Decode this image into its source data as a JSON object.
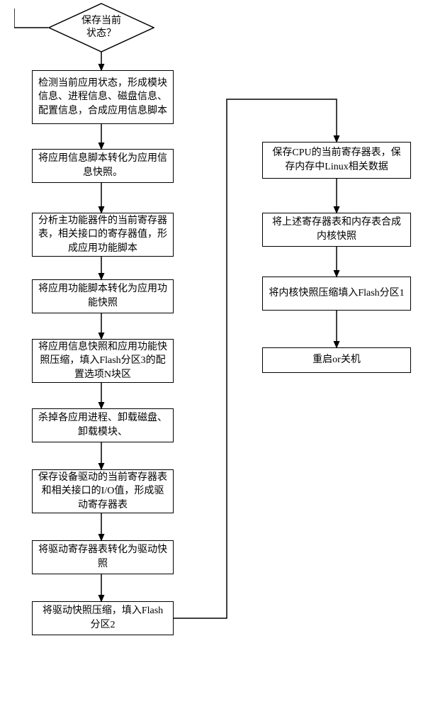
{
  "chart_data": {
    "type": "flowchart",
    "direction": "top-to-bottom",
    "nodes": [
      {
        "id": "d1",
        "type": "decision",
        "text": "保存当前\n状态？"
      },
      {
        "id": "p1",
        "type": "process",
        "text": "检测当前应用状态，形成模块信息、进程信息、磁盘信息、配置信息，合成应用信息脚本"
      },
      {
        "id": "p2",
        "type": "process",
        "text": "将应用信息脚本转化为应用信息快照。"
      },
      {
        "id": "p3",
        "type": "process",
        "text": "分析主功能器件的当前寄存器表，相关接口的寄存器值，形成应用功能脚本"
      },
      {
        "id": "p4",
        "type": "process",
        "text": "将应用功能脚本转化为应用功能快照"
      },
      {
        "id": "p5",
        "type": "process",
        "text": "将应用信息快照和应用功能快照压缩，填入Flash分区3的配置选项N块区"
      },
      {
        "id": "p6",
        "type": "process",
        "text": "杀掉各应用进程、卸载磁盘、卸载模块、"
      },
      {
        "id": "p7",
        "type": "process",
        "text": "保存设备驱动的当前寄存器表和相关接口的I/O值，形成驱动寄存器表"
      },
      {
        "id": "p8",
        "type": "process",
        "text": "将驱动寄存器表转化为驱动快照"
      },
      {
        "id": "p9",
        "type": "process",
        "text": "将驱动快照压缩，填入Flash分区2"
      },
      {
        "id": "p10",
        "type": "process",
        "text": "保存CPU的当前寄存器表，保存内存中Linux相关数据"
      },
      {
        "id": "p11",
        "type": "process",
        "text": "将上述寄存器表和内存表合成内核快照"
      },
      {
        "id": "p12",
        "type": "process",
        "text": "将内核快照压缩填入Flash分区1"
      },
      {
        "id": "p13",
        "type": "process",
        "text": "重启or关机"
      }
    ],
    "edges": [
      {
        "from": "d1",
        "to": "p1"
      },
      {
        "from": "p1",
        "to": "p2"
      },
      {
        "from": "p2",
        "to": "p3"
      },
      {
        "from": "p3",
        "to": "p4"
      },
      {
        "from": "p4",
        "to": "p5"
      },
      {
        "from": "p5",
        "to": "p6"
      },
      {
        "from": "p6",
        "to": "p7"
      },
      {
        "from": "p7",
        "to": "p8"
      },
      {
        "from": "p8",
        "to": "p9"
      },
      {
        "from": "p9",
        "to": "p10"
      },
      {
        "from": "p10",
        "to": "p11"
      },
      {
        "from": "p11",
        "to": "p12"
      },
      {
        "from": "p12",
        "to": "p13"
      }
    ]
  },
  "decision": {
    "text_line1": "保存当前",
    "text_line2": "状态？"
  },
  "steps": {
    "p1": "检测当前应用状态，形成模块信息、进程信息、磁盘信息、配置信息，合成应用信息脚本",
    "p2": "将应用信息脚本转化为应用信息快照。",
    "p3": "分析主功能器件的当前寄存器表，相关接口的寄存器值，形成应用功能脚本",
    "p4": "将应用功能脚本转化为应用功能快照",
    "p5": "将应用信息快照和应用功能快照压缩，填入Flash分区3的配置选项N块区",
    "p6": "杀掉各应用进程、卸载磁盘、卸载模块、",
    "p7": "保存设备驱动的当前寄存器表和相关接口的I/O值，形成驱动寄存器表",
    "p8": "将驱动寄存器表转化为驱动快照",
    "p9": "将驱动快照压缩，填入Flash分区2",
    "p10": "保存CPU的当前寄存器表，保存内存中Linux相关数据",
    "p11": "将上述寄存器表和内存表合成内核快照",
    "p12": "将内核快照压缩填入Flash分区1",
    "p13": "重启or关机"
  }
}
